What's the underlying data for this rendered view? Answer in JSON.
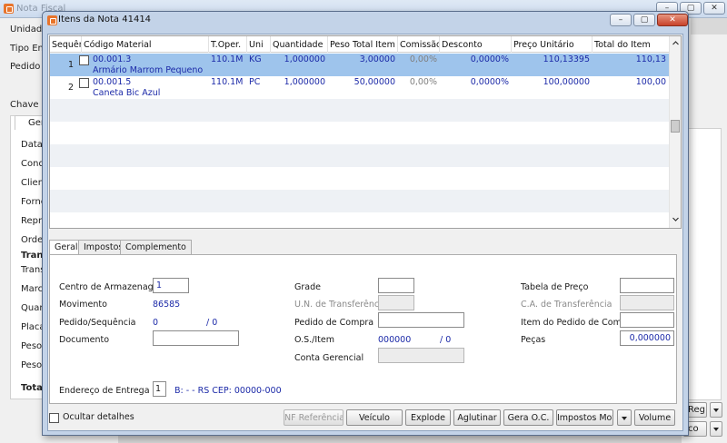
{
  "parent": {
    "title": "Nota Fiscal",
    "labels": [
      "Unidade",
      "Tipo Emis",
      "Pedido",
      "Chave N",
      "Data",
      "Condi",
      "Client",
      "Forne",
      "Repre",
      "Order",
      "Tran",
      "Trans",
      "Marca",
      "Quan",
      "Placa",
      "Peso",
      "Peso",
      "Tota"
    ],
    "tab_label": "Ger",
    "button_labels": [
      "Reg.",
      "co"
    ]
  },
  "dialog": {
    "title": "Itens da Nota 41414",
    "columns": [
      "Sequência",
      "Código Material",
      "T.Oper.",
      "Uni",
      "Quantidade",
      "Peso Total Item",
      "Comissão",
      "Desconto",
      "Preço Unitário",
      "Total do Item"
    ],
    "rows": [
      {
        "seq": "1",
        "code": "00.001.3",
        "desc": "Armário Marrom Pequeno",
        "top": "110.1M",
        "uni": "KG",
        "qty": "1,000000",
        "weight": "3,00000",
        "commission": "0,00%",
        "discount": "0,0000%",
        "unit_price": "110,13395",
        "total": "110,13"
      },
      {
        "seq": "2",
        "code": "00.001.5",
        "desc": "Caneta Bic Azul",
        "top": "110.1M",
        "uni": "PC",
        "qty": "1,000000",
        "weight": "50,00000",
        "commission": "0,00%",
        "discount": "0,0000%",
        "unit_price": "100,00000",
        "total": "100,00"
      }
    ],
    "tabs": [
      "Geral",
      "Impostos",
      "Complemento"
    ],
    "form": {
      "centro_label": "Centro de Armazenagem",
      "centro_value": "1",
      "movimento_label": "Movimento",
      "movimento_value": "86585",
      "pedido_seq_label": "Pedido/Sequência",
      "pedido_seq_value": "0",
      "pedido_seq_sep": "/ 0",
      "documento_label": "Documento",
      "documento_value": "",
      "grade_label": "Grade",
      "grade_value": "",
      "un_transf_label": "U.N. de Transferência",
      "un_transf_value": "",
      "pedido_compra_label": "Pedido de Compra",
      "pedido_compra_value": "",
      "os_item_label": "O.S./Item",
      "os_item_value": "000000",
      "os_item_sep": "/ 0",
      "conta_gerencial_label": "Conta Gerencial",
      "conta_gerencial_value": "",
      "tabela_preco_label": "Tabela de Preço",
      "tabela_preco_value": "",
      "ca_transf_label": "C.A. de Transferência",
      "ca_transf_value": "",
      "item_pedido_compra_label": "Item do Pedido de Compra",
      "item_pedido_compra_value": "",
      "pecas_label": "Peças",
      "pecas_value": "0,000000",
      "endereco_label": "Endereço de Entrega",
      "endereco_value": "1",
      "endereco_text": "B: - - RS CEP: 00000-000"
    },
    "footer": {
      "hide_details": "Ocultar detalhes",
      "buttons": [
        "NF Referência",
        "Veículo",
        "Explode",
        "Aglutinar",
        "Gera O.C.",
        "Impostos Movto",
        "Volume"
      ]
    },
    "accent_selected_row": "#9ec4ec",
    "value_text_color": "#1c2aa8"
  }
}
